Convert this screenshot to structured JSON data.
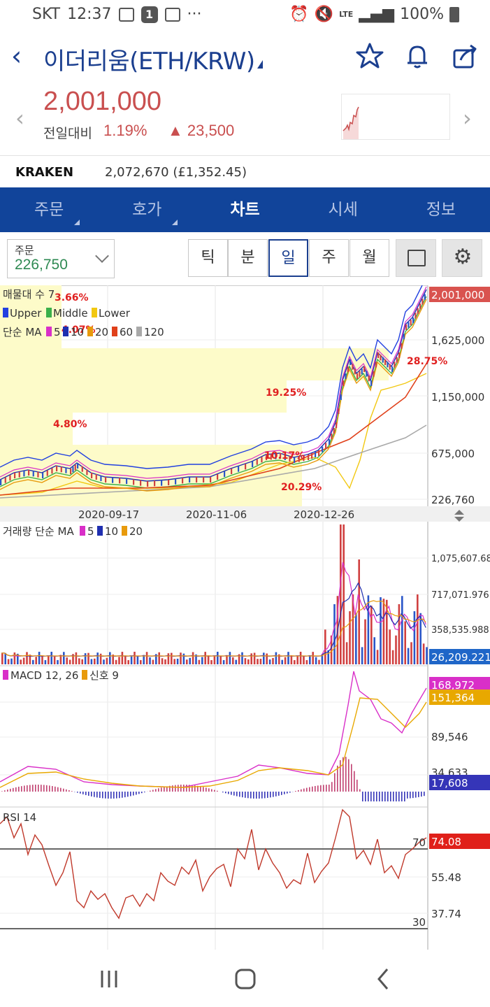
{
  "status_bar": {
    "carrier": "SKT",
    "time": "12:37",
    "notification_icons": [
      "image-icon",
      "badge-1-icon",
      "dmb-icon",
      "more-icon"
    ],
    "badge_text": "1",
    "dots": "···",
    "right_icons": [
      "alarm-icon",
      "mute-icon",
      "lte-icon",
      "signal-icon",
      "battery-icon"
    ],
    "lte_label": "LTE",
    "battery": "100%"
  },
  "header": {
    "title": "이더리움(ETH/KRW)",
    "back_glyph": "‹",
    "icons": [
      "star-icon",
      "bell-icon",
      "share-icon"
    ]
  },
  "quote": {
    "price": "2,001,000",
    "change_label": "전일대비",
    "change_pct": "1.19%",
    "change_amount": "▲ 23,500",
    "color_up": "#c94f4f"
  },
  "kraken": {
    "exchange": "KRAKEN",
    "value": "2,072,670 (£1,352.45)"
  },
  "tabs": [
    {
      "label": "주문",
      "active": false,
      "dropdown": true
    },
    {
      "label": "호가",
      "active": false,
      "dropdown": true
    },
    {
      "label": "차트",
      "active": true,
      "dropdown": false
    },
    {
      "label": "시세",
      "active": false,
      "dropdown": false
    },
    {
      "label": "정보",
      "active": false,
      "dropdown": false
    }
  ],
  "toolbar": {
    "order_label": "주문",
    "order_qty": "226,750",
    "periods": [
      "틱",
      "분",
      "일",
      "주",
      "월"
    ],
    "selected_period": "일"
  },
  "chart": {
    "main_legend_1": "매물대 수 7",
    "bb_upper": "Upper",
    "bb_middle": "Middle",
    "bb_lower": "Lower",
    "ma_label": "단순 MA",
    "ma_periods": [
      "5",
      "10",
      "20",
      "60",
      "120"
    ],
    "ma_colors": [
      "#d92fc8",
      "#1f2fb0",
      "#e89a0c",
      "#e0401a",
      "#a9a9a9"
    ],
    "price_ticks": [
      "1,625,000",
      "1,150,000",
      "675,000",
      "226,760"
    ],
    "last_price": "2,001,000",
    "volume_profile_pcts": [
      "3.66%",
      "4.07%",
      "28.75%",
      "19.25%",
      "4.80%",
      "10.17%",
      "20.29%"
    ],
    "dates": [
      "2020-09-17",
      "2020-11-06",
      "2020-12-26"
    ],
    "volume_legend": "거래량 단순 MA",
    "volume_ma": [
      "5",
      "10",
      "20"
    ],
    "volume_ticks": [
      "1,075,607.685",
      "717,071.976",
      "358,535.988"
    ],
    "volume_last": "26,209.221",
    "macd_legend": "MACD 12, 26",
    "signal_legend": "신호 9",
    "macd_ticks": [
      "89,546",
      "34,633"
    ],
    "macd_last": "168,972",
    "signal_last": "151,364",
    "macd_hist_last": "17,608",
    "rsi_legend": "RSI 14",
    "rsi_ticks": [
      "55.48",
      "37.74"
    ],
    "rsi_upper": "70",
    "rsi_lower": "30",
    "rsi_last": "74.08"
  },
  "nav": {
    "icons": [
      "recent-apps-icon",
      "home-icon",
      "back-icon"
    ]
  }
}
